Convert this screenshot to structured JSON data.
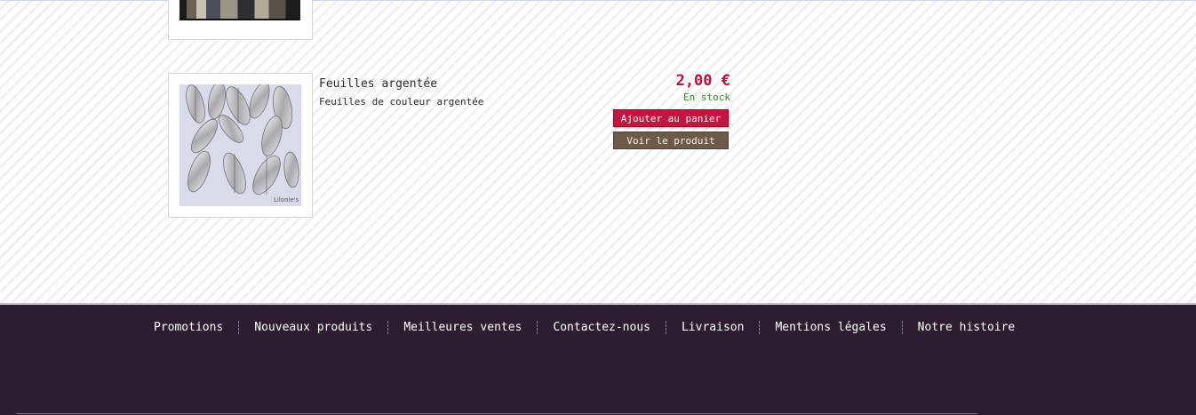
{
  "products": [
    {
      "name": "Feuilles argentée",
      "description": "Feuilles de couleur argentée",
      "price": "2,00 €",
      "stock": "En stock",
      "add_to_cart_label": "Ajouter au panier",
      "view_label": "Voir le produit",
      "image_watermark": "Lilonie's"
    }
  ],
  "footer": {
    "links": [
      "Promotions",
      "Nouveaux produits",
      "Meilleures ventes",
      "Contactez-nous",
      "Livraison",
      "Mentions légales",
      "Notre histoire"
    ]
  },
  "colors": {
    "price": "#b5123e",
    "stock": "#3a8a2a",
    "cart_button": "#c0163f",
    "view_button": "#6e5a48",
    "footer_bg": "#2c1e30"
  }
}
